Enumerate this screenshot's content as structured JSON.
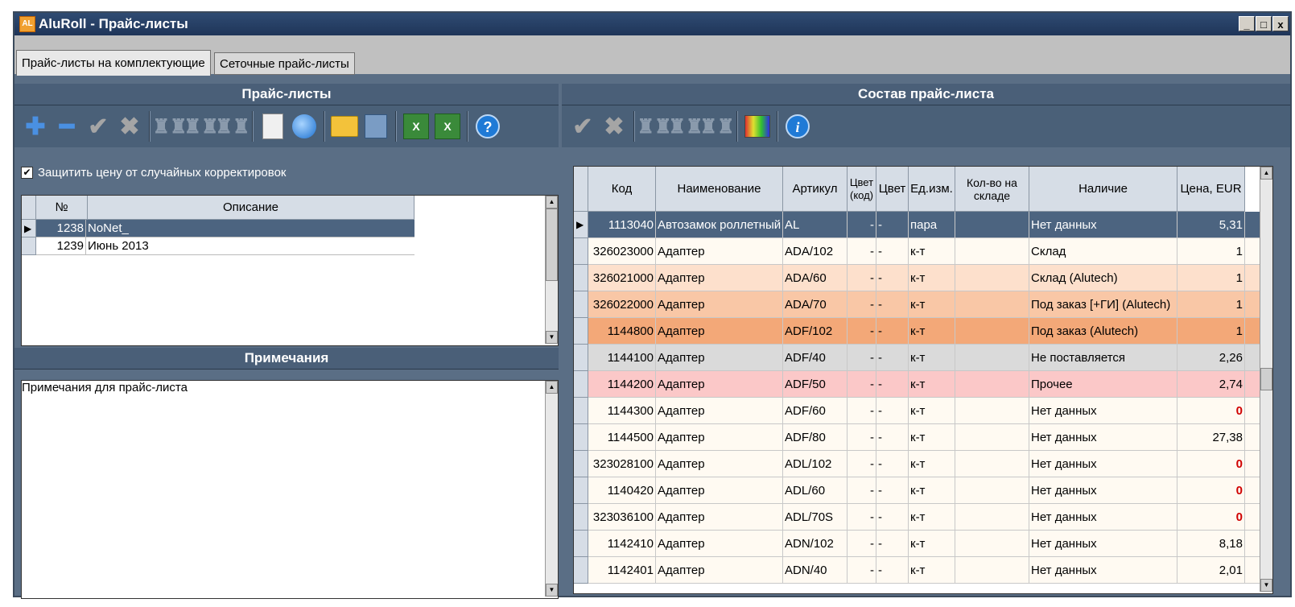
{
  "window": {
    "title": "AluRoll - Прайс-листы",
    "app_icon": "AL",
    "controls": [
      "_",
      "□",
      "x"
    ]
  },
  "tabs": [
    {
      "label": "Прайс-листы на комплектующие",
      "active": true
    },
    {
      "label": "Сеточные прайс-листы",
      "active": false
    }
  ],
  "left": {
    "header": "Прайс-листы",
    "toolbar": [
      "add-icon",
      "remove-icon",
      "check-icon",
      "cross-icon",
      "binoculars-icon",
      "binoculars-next-icon",
      "binoculars-prev-icon",
      "copy-icon",
      "circle-icon",
      "folder-open-icon",
      "save-icon",
      "excel-import-icon",
      "excel-export-icon",
      "help-icon"
    ],
    "protect_checkbox": {
      "label": "Защитить цену от случайных корректировок",
      "checked": true
    },
    "columns": [
      "№",
      "Описание"
    ],
    "rows": [
      {
        "n": "1238",
        "d": "NoNet_",
        "selected": true
      },
      {
        "n": "1239",
        "d": "Июнь 2013",
        "selected": false
      }
    ],
    "notes_header": "Примечания",
    "notes_text": "Примечания для прайс-листа"
  },
  "right": {
    "header": "Состав прайс-листа",
    "toolbar": [
      "check-icon",
      "cross-icon",
      "binoculars-icon",
      "binoculars-next-icon",
      "binoculars-prev-icon",
      "palette-icon",
      "info-icon"
    ],
    "columns": [
      "Код",
      "Наименование",
      "Артикул",
      "Цвет (код)",
      "Цвет",
      "Ед.изм.",
      "Кол-во на складе",
      "Наличие",
      "Цена, EUR"
    ],
    "rows": [
      {
        "code": "1113040",
        "name": "Автозамок роллетный",
        "art": "AL",
        "ccode": "-",
        "color": "-",
        "unit": "пара",
        "qty": "",
        "avail": "Нет данных",
        "price": "5,31",
        "bg": "#4c6480",
        "selected": true
      },
      {
        "code": "326023000",
        "name": "Адаптер",
        "art": "ADA/102",
        "ccode": "-",
        "color": "-",
        "unit": "к-т",
        "qty": "",
        "avail": "Склад",
        "price": "1",
        "bg": "#fffaf2"
      },
      {
        "code": "326021000",
        "name": "Адаптер",
        "art": "ADA/60",
        "ccode": "-",
        "color": "-",
        "unit": "к-т",
        "qty": "",
        "avail": "Склад (Alutech)",
        "price": "1",
        "bg": "#fde0cc"
      },
      {
        "code": "326022000",
        "name": "Адаптер",
        "art": "ADA/70",
        "ccode": "-",
        "color": "-",
        "unit": "к-т",
        "qty": "",
        "avail": "Под заказ [+ГИ] (Alutech)",
        "price": "1",
        "bg": "#f9c7a6"
      },
      {
        "code": "1144800",
        "name": "Адаптер",
        "art": "ADF/102",
        "ccode": "-",
        "color": "-",
        "unit": "к-т",
        "qty": "",
        "avail": "Под заказ (Alutech)",
        "price": "1",
        "bg": "#f3a878"
      },
      {
        "code": "1144100",
        "name": "Адаптер",
        "art": "ADF/40",
        "ccode": "-",
        "color": "-",
        "unit": "к-т",
        "qty": "",
        "avail": "Не поставляется",
        "price": "2,26",
        "bg": "#dadada"
      },
      {
        "code": "1144200",
        "name": "Адаптер",
        "art": "ADF/50",
        "ccode": "-",
        "color": "-",
        "unit": "к-т",
        "qty": "",
        "avail": "Прочее",
        "price": "2,74",
        "bg": "#fbc8c8"
      },
      {
        "code": "1144300",
        "name": "Адаптер",
        "art": "ADF/60",
        "ccode": "-",
        "color": "-",
        "unit": "к-т",
        "qty": "",
        "avail": "Нет данных",
        "price": "0",
        "bg": "#fffaf2"
      },
      {
        "code": "1144500",
        "name": "Адаптер",
        "art": "ADF/80",
        "ccode": "-",
        "color": "-",
        "unit": "к-т",
        "qty": "",
        "avail": "Нет данных",
        "price": "27,38",
        "bg": "#fffaf2"
      },
      {
        "code": "323028100",
        "name": "Адаптер",
        "art": "ADL/102",
        "ccode": "-",
        "color": "-",
        "unit": "к-т",
        "qty": "",
        "avail": "Нет данных",
        "price": "0",
        "bg": "#fffaf2"
      },
      {
        "code": "1140420",
        "name": "Адаптер",
        "art": "ADL/60",
        "ccode": "-",
        "color": "-",
        "unit": "к-т",
        "qty": "",
        "avail": "Нет данных",
        "price": "0",
        "bg": "#fffaf2"
      },
      {
        "code": "323036100",
        "name": "Адаптер",
        "art": "ADL/70S",
        "ccode": "-",
        "color": "-",
        "unit": "к-т",
        "qty": "",
        "avail": "Нет данных",
        "price": "0",
        "bg": "#fffaf2"
      },
      {
        "code": "1142410",
        "name": "Адаптер",
        "art": "ADN/102",
        "ccode": "-",
        "color": "-",
        "unit": "к-т",
        "qty": "",
        "avail": "Нет данных",
        "price": "8,18",
        "bg": "#fffaf2"
      },
      {
        "code": "1142401",
        "name": "Адаптер",
        "art": "ADN/40",
        "ccode": "-",
        "color": "-",
        "unit": "к-т",
        "qty": "",
        "avail": "Нет данных",
        "price": "2,01",
        "bg": "#fffaf2"
      }
    ]
  }
}
